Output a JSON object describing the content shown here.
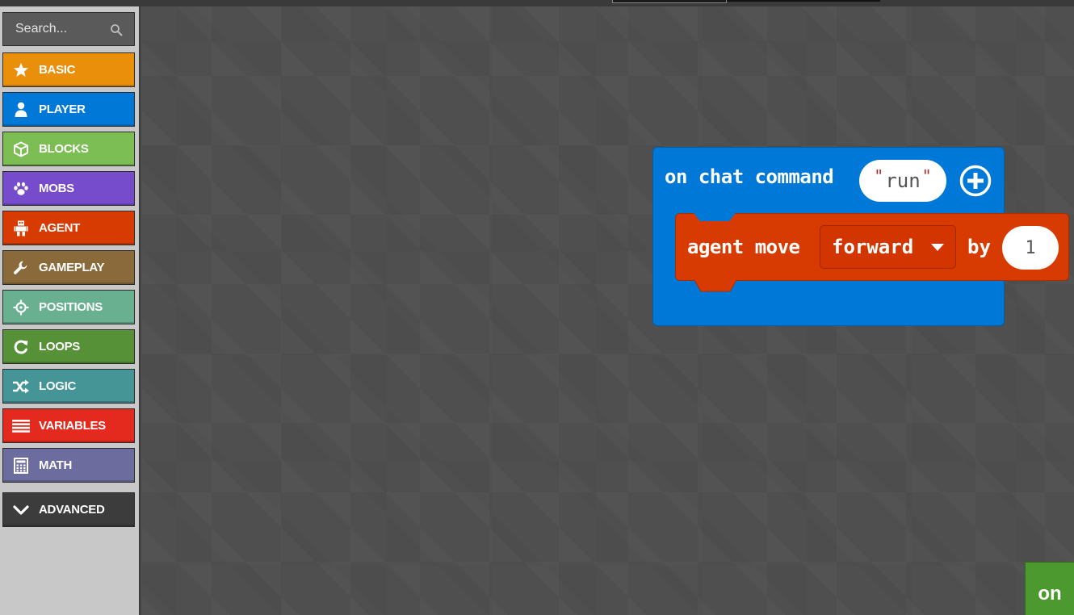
{
  "search": {
    "placeholder": "Search..."
  },
  "categories": [
    {
      "label": "BASIC",
      "icon": "star-icon",
      "color": "#e98f0a"
    },
    {
      "label": "PLAYER",
      "icon": "person-icon",
      "color": "#0078d7"
    },
    {
      "label": "BLOCKS",
      "icon": "cube-icon",
      "color": "#7cbd54"
    },
    {
      "label": "MOBS",
      "icon": "paw-icon",
      "color": "#764bcc"
    },
    {
      "label": "AGENT",
      "icon": "agent-icon",
      "color": "#d83b01"
    },
    {
      "label": "GAMEPLAY",
      "icon": "wrench-icon",
      "color": "#8a6a3b"
    },
    {
      "label": "POSITIONS",
      "icon": "crosshair-icon",
      "color": "#69b090"
    },
    {
      "label": "LOOPS",
      "icon": "loop-icon",
      "color": "#569138"
    },
    {
      "label": "LOGIC",
      "icon": "shuffle-icon",
      "color": "#459597"
    },
    {
      "label": "VARIABLES",
      "icon": "lines-icon",
      "color": "#e4291f"
    },
    {
      "label": "MATH",
      "icon": "calculator-icon",
      "color": "#6c6c9f"
    },
    {
      "label": "ADVANCED",
      "icon": "chevron-down-icon",
      "color": "#3c3c3c"
    }
  ],
  "workspace": {
    "event_block": {
      "label": "on chat command",
      "command_value": "run",
      "color": "#0078d7"
    },
    "statement_block": {
      "label": "agent move",
      "direction": "forward",
      "by_label": "by",
      "amount": "1",
      "color": "#d83b01"
    }
  },
  "on_button": {
    "label": "on",
    "color": "#4c9a2f"
  }
}
